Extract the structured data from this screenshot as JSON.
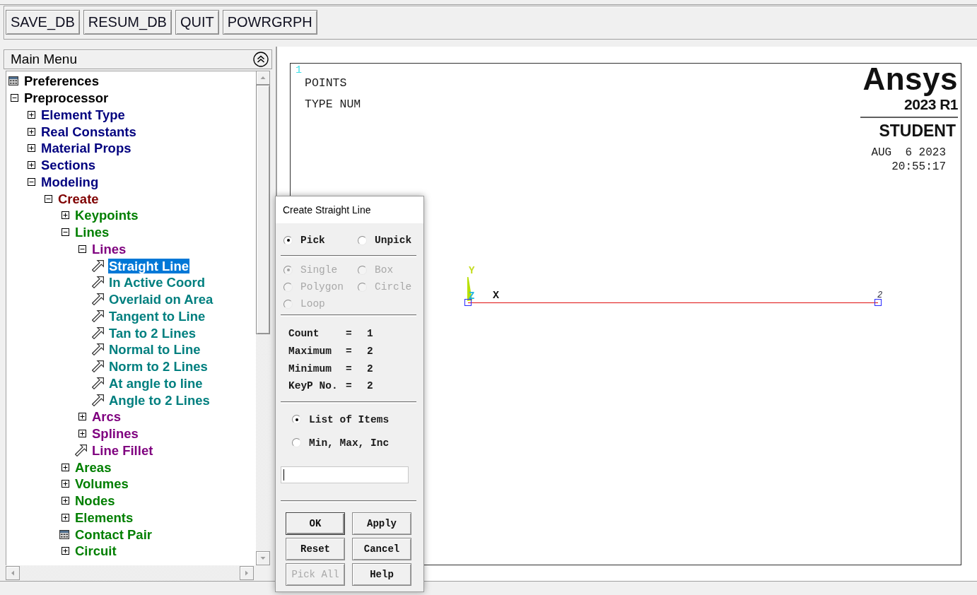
{
  "toolbar": {
    "buttons": [
      "SAVE_DB",
      "RESUM_DB",
      "QUIT",
      "POWRGRPH"
    ]
  },
  "main_menu": {
    "title": "Main Menu",
    "items": [
      {
        "label": "Preferences",
        "kind": "dialog",
        "selected": false
      },
      {
        "label": "Preprocessor",
        "kind": "folder",
        "expanded": true,
        "selected": false,
        "children": [
          {
            "label": "Element Type",
            "kind": "folder",
            "expanded": false,
            "selected": false
          },
          {
            "label": "Real Constants",
            "kind": "folder",
            "expanded": false,
            "selected": false
          },
          {
            "label": "Material Props",
            "kind": "folder",
            "expanded": false,
            "selected": false
          },
          {
            "label": "Sections",
            "kind": "folder",
            "expanded": false,
            "selected": false
          },
          {
            "label": "Modeling",
            "kind": "folder",
            "expanded": true,
            "selected": false,
            "children": [
              {
                "label": "Create",
                "kind": "folder",
                "expanded": true,
                "selected": false,
                "children": [
                  {
                    "label": "Keypoints",
                    "kind": "folder",
                    "expanded": false,
                    "selected": false
                  },
                  {
                    "label": "Lines",
                    "kind": "folder",
                    "expanded": true,
                    "selected": false,
                    "children": [
                      {
                        "label": "Lines",
                        "kind": "folder",
                        "expanded": true,
                        "selected": false,
                        "children": [
                          {
                            "label": "Straight Line",
                            "kind": "action",
                            "selected": true
                          },
                          {
                            "label": "In Active Coord",
                            "kind": "action",
                            "selected": false
                          },
                          {
                            "label": "Overlaid on Area",
                            "kind": "action",
                            "selected": false
                          },
                          {
                            "label": "Tangent to Line",
                            "kind": "action",
                            "selected": false
                          },
                          {
                            "label": "Tan to 2 Lines",
                            "kind": "action",
                            "selected": false
                          },
                          {
                            "label": "Normal to Line",
                            "kind": "action",
                            "selected": false
                          },
                          {
                            "label": "Norm to 2 Lines",
                            "kind": "action",
                            "selected": false
                          },
                          {
                            "label": "At angle to line",
                            "kind": "action",
                            "selected": false
                          },
                          {
                            "label": "Angle to 2 Lines",
                            "kind": "action",
                            "selected": false
                          }
                        ]
                      },
                      {
                        "label": "Arcs",
                        "kind": "folder",
                        "expanded": false,
                        "selected": false
                      },
                      {
                        "label": "Splines",
                        "kind": "folder",
                        "expanded": false,
                        "selected": false
                      },
                      {
                        "label": "Line Fillet",
                        "kind": "action",
                        "selected": false
                      }
                    ]
                  },
                  {
                    "label": "Areas",
                    "kind": "folder",
                    "expanded": false,
                    "selected": false
                  },
                  {
                    "label": "Volumes",
                    "kind": "folder",
                    "expanded": false,
                    "selected": false
                  },
                  {
                    "label": "Nodes",
                    "kind": "folder",
                    "expanded": false,
                    "selected": false
                  },
                  {
                    "label": "Elements",
                    "kind": "folder",
                    "expanded": false,
                    "selected": false
                  },
                  {
                    "label": "Contact Pair",
                    "kind": "dialog",
                    "selected": false
                  },
                  {
                    "label": "Circuit",
                    "kind": "folder",
                    "expanded": false,
                    "selected": false
                  }
                ]
              }
            ]
          }
        ]
      }
    ]
  },
  "graphics": {
    "window_number": "1",
    "legend": [
      "POINTS",
      "TYPE NUM"
    ],
    "logo": {
      "brand": "Ansys",
      "version": "2023 R1",
      "edition": "STUDENT"
    },
    "date": "AUG  6 2023",
    "time": "20:55:17",
    "triad": [
      {
        "kind": "vertical",
        "label": "Y"
      },
      {
        "kind": "normal",
        "label": "Z"
      },
      {
        "kind": "horizontal",
        "label": "X"
      }
    ],
    "keypoints": [
      {
        "kind": "keypoint"
      },
      {
        "kind": "keypoint",
        "label": "2"
      }
    ],
    "lines": [
      {
        "kind": "straight"
      }
    ]
  },
  "dialog": {
    "title": "Create Straight Line",
    "pick_mode": [
      {
        "label": "Pick",
        "selected": true
      },
      {
        "label": "Unpick",
        "selected": false
      }
    ],
    "pick_shape": [
      {
        "label": "Single",
        "selected": true,
        "disabled": true
      },
      {
        "label": "Box",
        "selected": false,
        "disabled": true
      },
      {
        "label": "Polygon",
        "selected": false,
        "disabled": true
      },
      {
        "label": "Circle",
        "selected": false,
        "disabled": true
      },
      {
        "label": "Loop",
        "selected": false,
        "disabled": true
      }
    ],
    "counts": [
      {
        "label": "Count",
        "sign": "=",
        "value": "1"
      },
      {
        "label": "Maximum",
        "sign": "=",
        "value": "2"
      },
      {
        "label": "Minimum",
        "sign": "=",
        "value": "2"
      },
      {
        "label": "KeyP No.",
        "sign": "=",
        "value": "2"
      }
    ],
    "entry_mode": [
      {
        "label": "List of Items",
        "selected": true
      },
      {
        "label": "Min, Max, Inc",
        "selected": false
      }
    ],
    "entry_field": {
      "focused": true
    },
    "buttons": [
      {
        "label": "OK",
        "default": true,
        "disabled": false
      },
      {
        "label": "Apply",
        "default": false,
        "disabled": false
      },
      {
        "label": "Reset",
        "default": false,
        "disabled": false
      },
      {
        "label": "Cancel",
        "default": false,
        "disabled": false
      },
      {
        "label": "Pick All",
        "default": false,
        "disabled": true
      },
      {
        "label": "Help",
        "default": false,
        "disabled": false
      }
    ]
  }
}
